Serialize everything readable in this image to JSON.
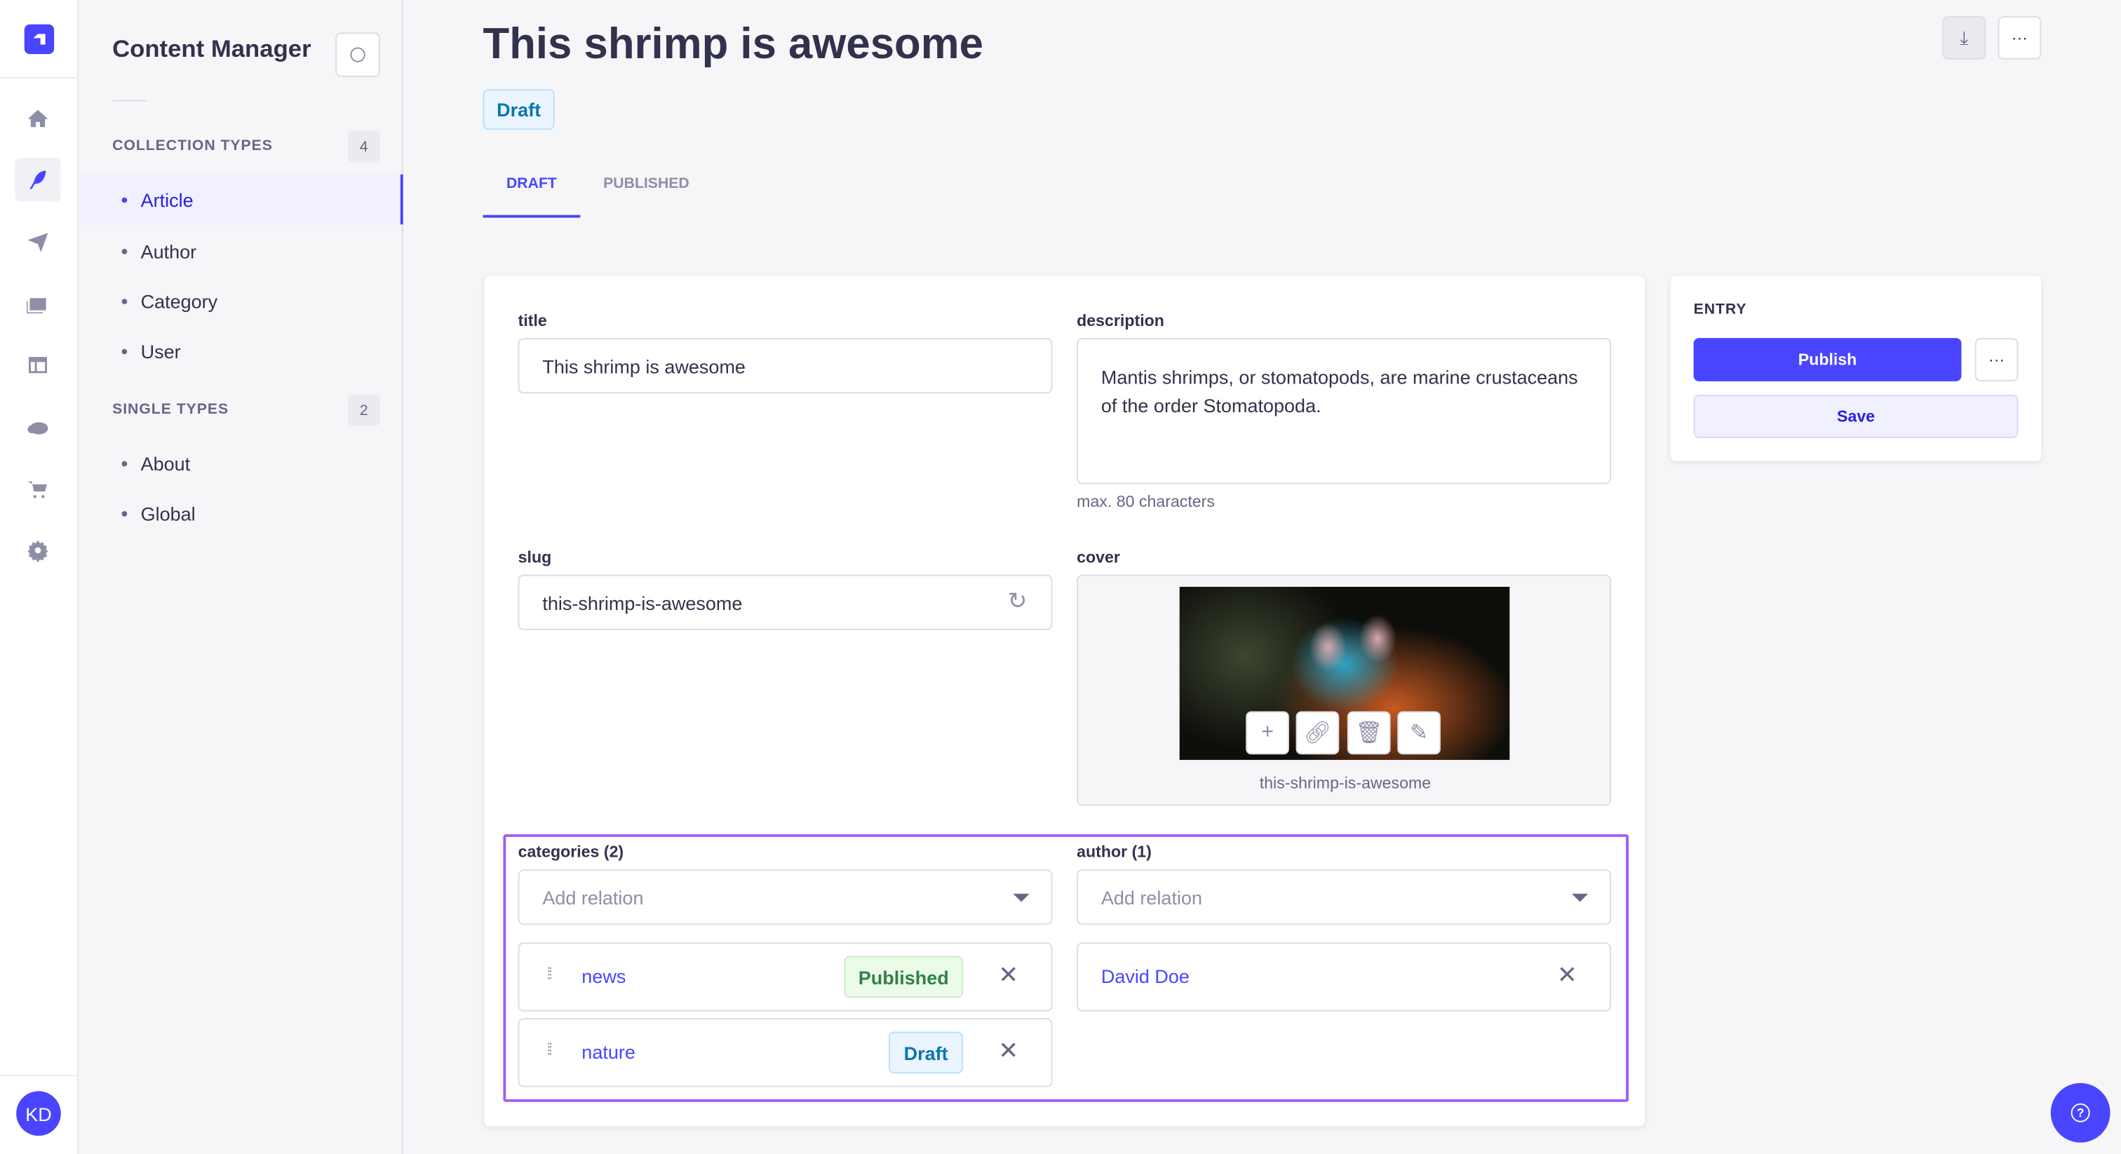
{
  "nav": {
    "avatar": "KD",
    "items": [
      "home-icon",
      "content-manager-icon",
      "send-icon",
      "media-library-icon",
      "layout-icon",
      "cloud-icon",
      "cart-icon",
      "settings-icon"
    ],
    "active": "content-manager-icon"
  },
  "sidebar": {
    "title": "Content Manager",
    "collection_label": "COLLECTION TYPES",
    "collection_count": "4",
    "collection_items": [
      "Article",
      "Author",
      "Category",
      "User"
    ],
    "single_label": "SINGLE TYPES",
    "single_count": "2",
    "single_items": [
      "About",
      "Global"
    ]
  },
  "header": {
    "title": "This shrimp is awesome",
    "status": "Draft",
    "tabs": [
      "DRAFT",
      "PUBLISHED"
    ]
  },
  "form": {
    "title_label": "title",
    "title_value": "This shrimp is awesome",
    "description_label": "description",
    "description_value": "Mantis shrimps, or stomatopods, are marine crustaceans of the order Stomatopoda.",
    "description_hint": "max. 80 characters",
    "slug_label": "slug",
    "slug_value": "this-shrimp-is-awesome",
    "cover_label": "cover",
    "cover_caption": "this-shrimp-is-awesome",
    "categories_label": "categories (2)",
    "categories_placeholder": "Add relation",
    "categories": [
      {
        "name": "news",
        "status": "Published"
      },
      {
        "name": "nature",
        "status": "Draft"
      }
    ],
    "author_label": "author (1)",
    "author_placeholder": "Add relation",
    "authors": [
      {
        "name": "David Doe"
      }
    ]
  },
  "entry": {
    "label": "ENTRY",
    "publish": "Publish",
    "save": "Save",
    "more": "···"
  },
  "colors": {
    "primary": "#4945ff",
    "highlight": "#9f5cf5",
    "published": "#328048",
    "draft": "#0c75af"
  }
}
